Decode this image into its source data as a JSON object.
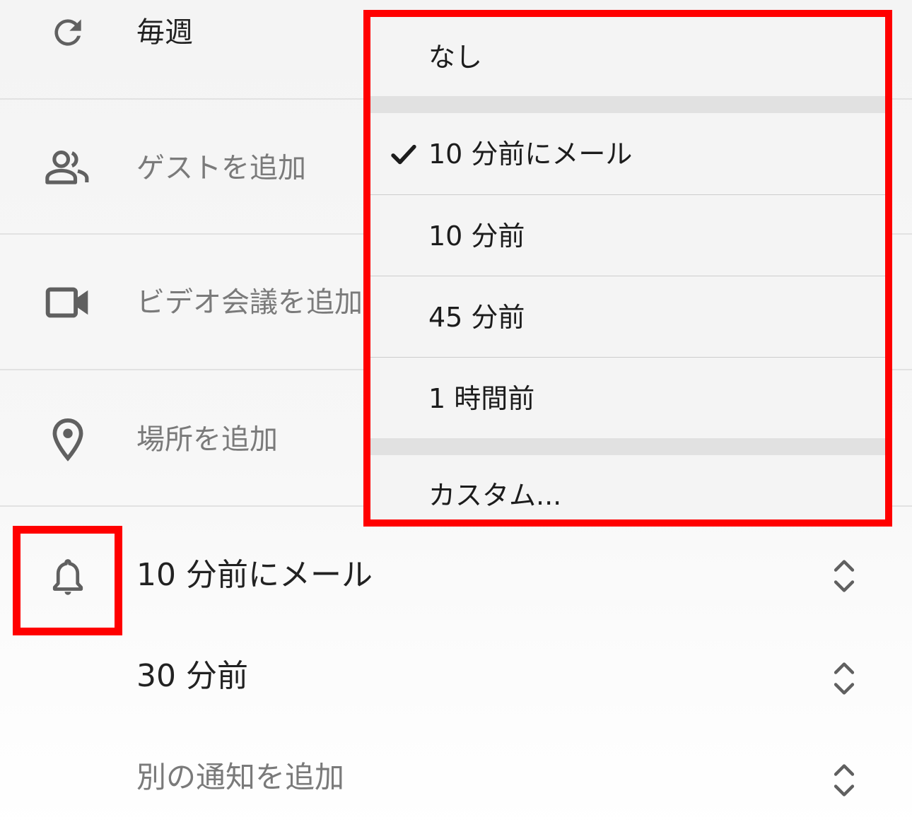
{
  "form": {
    "repeat": {
      "label": "毎週",
      "icon": "repeat-icon"
    },
    "guests": {
      "label": "ゲストを追加",
      "icon": "people-icon"
    },
    "video": {
      "label": "ビデオ会議を追加",
      "icon": "video-camera-icon"
    },
    "location": {
      "label": "場所を追加",
      "icon": "location-pin-icon"
    },
    "notifications": [
      {
        "label": "10 分前にメール",
        "icon": "bell-icon"
      },
      {
        "label": "30 分前"
      },
      {
        "label": "別の通知を追加"
      }
    ]
  },
  "dropdown": {
    "options": [
      {
        "label": "なし",
        "selected": false
      },
      {
        "label": "10 分前にメール",
        "selected": true
      },
      {
        "label": "10 分前",
        "selected": false
      },
      {
        "label": "45 分前",
        "selected": false
      },
      {
        "label": "1 時間前",
        "selected": false
      },
      {
        "label": "カスタム...",
        "selected": false
      }
    ]
  },
  "colors": {
    "highlight": "#ff0000",
    "icon": "#606060",
    "muted_text": "#7a7a7a",
    "text": "#222222"
  }
}
